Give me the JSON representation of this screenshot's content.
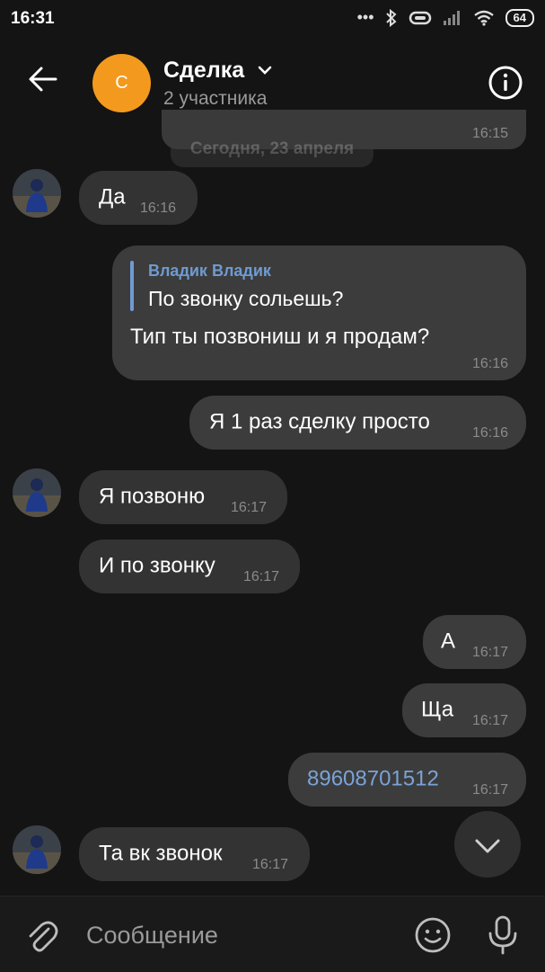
{
  "status_bar": {
    "time": "16:31",
    "battery": "64"
  },
  "header": {
    "avatar_letter": "С",
    "title": "Сделка",
    "subtitle": "2 участника"
  },
  "chat": {
    "prev_time": "16:15",
    "date_separator": "Сегодня, 23 апреля",
    "messages": [
      {
        "direction": "in",
        "text": "Да",
        "time": "16:16"
      },
      {
        "direction": "out",
        "reply_author": "Владик Владик",
        "reply_text": "По звонку сольешь?",
        "text": "Тип ты позвониш и я продам?",
        "time": "16:16"
      },
      {
        "direction": "out",
        "text": "Я 1 раз сделку просто",
        "time": "16:16"
      },
      {
        "direction": "in",
        "text": "Я позвоню",
        "time": "16:17"
      },
      {
        "direction": "in",
        "text": "И по звонку",
        "time": "16:17"
      },
      {
        "direction": "out",
        "text": "А",
        "time": "16:17"
      },
      {
        "direction": "out",
        "text": "Ща",
        "time": "16:17"
      },
      {
        "direction": "out",
        "text": "89608701512",
        "time": "16:17"
      },
      {
        "direction": "in",
        "text": "Та вк звонок",
        "time": "16:17"
      }
    ]
  },
  "composer": {
    "placeholder": "Сообщение"
  },
  "colors": {
    "accent_link": "#7aa3d6",
    "avatar_orange": "#f39a1e",
    "background": "#141414"
  }
}
